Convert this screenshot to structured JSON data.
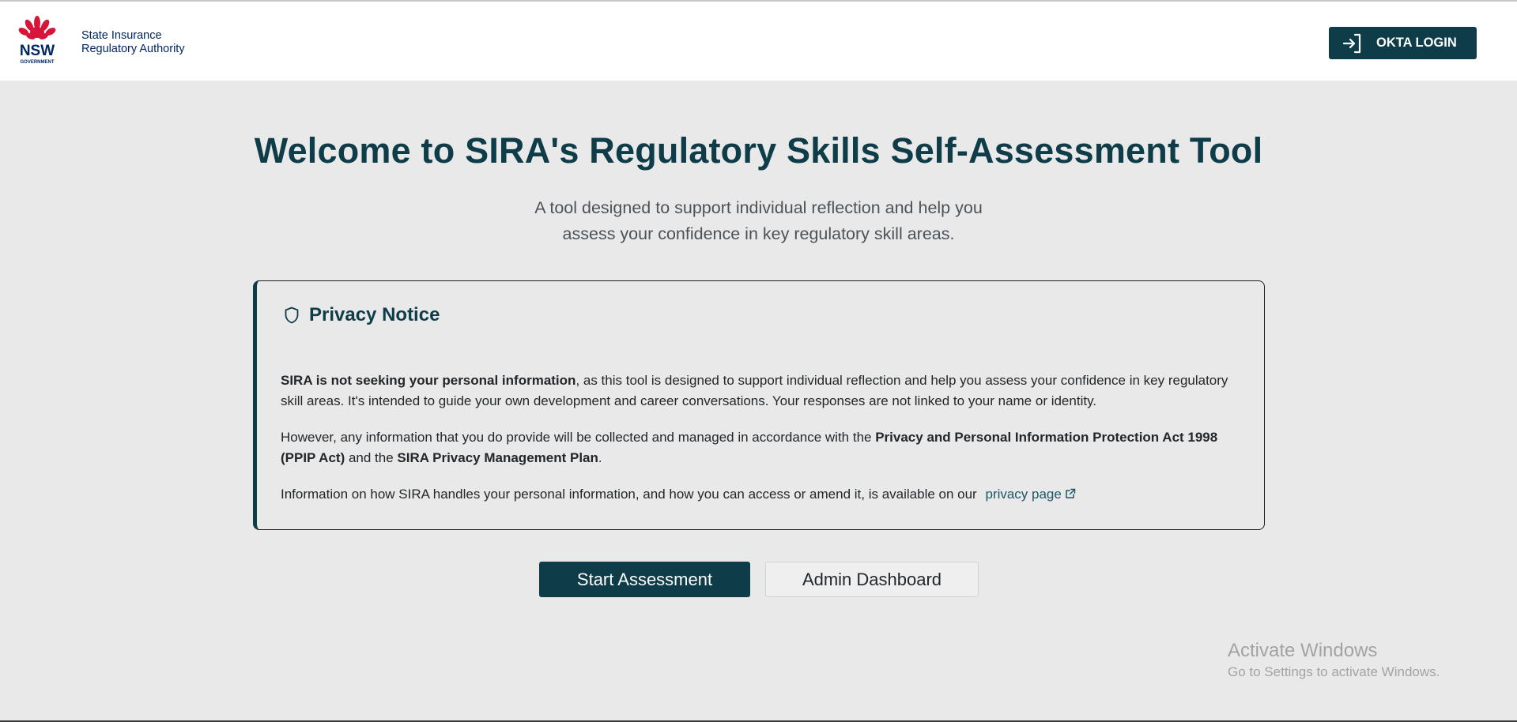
{
  "header": {
    "logo_wordmark": "NSW",
    "logo_subtext": "GOVERNMENT",
    "org_name_line1": "State Insurance",
    "org_name_line2": "Regulatory Authority",
    "login_label": "OKTA LOGIN",
    "login_icon": "sign-in-icon"
  },
  "main": {
    "title": "Welcome to SIRA's Regulatory Skills Self-Assessment Tool",
    "subtitle_line1": "A tool designed to support individual reflection and help you",
    "subtitle_line2": "assess your confidence in key regulatory skill areas."
  },
  "privacy_notice": {
    "icon": "shield-icon",
    "heading": "Privacy Notice",
    "p1_bold": "SIRA is not seeking your personal information",
    "p1_rest": ", as this tool is designed to support individual reflection and help you assess your confidence in key regulatory skill areas. It's intended to guide your own development and career conversations. Your responses are not linked to your name or identity.",
    "p2_start": "However, any information that you do provide will be collected and managed in accordance with the ",
    "p2_bold1": "Privacy and Personal Information Protection Act 1998 (PPIP Act)",
    "p2_mid": " and the ",
    "p2_bold2": "SIRA Privacy Management Plan",
    "p2_end": ".",
    "p3_text": "Information on how SIRA handles your personal information, and how you can access or amend it, is available on our ",
    "p3_link": "privacy page",
    "p3_link_icon": "external-link-icon"
  },
  "actions": {
    "start_label": "Start Assessment",
    "admin_label": "Admin Dashboard"
  },
  "watermark": {
    "line1": "Activate Windows",
    "line2": "Go to Settings to activate Windows."
  },
  "colors": {
    "brand_teal": "#0e3d49",
    "nsw_red": "#d7153a",
    "nsw_navy": "#002664",
    "page_bg": "#e9e9e9"
  }
}
